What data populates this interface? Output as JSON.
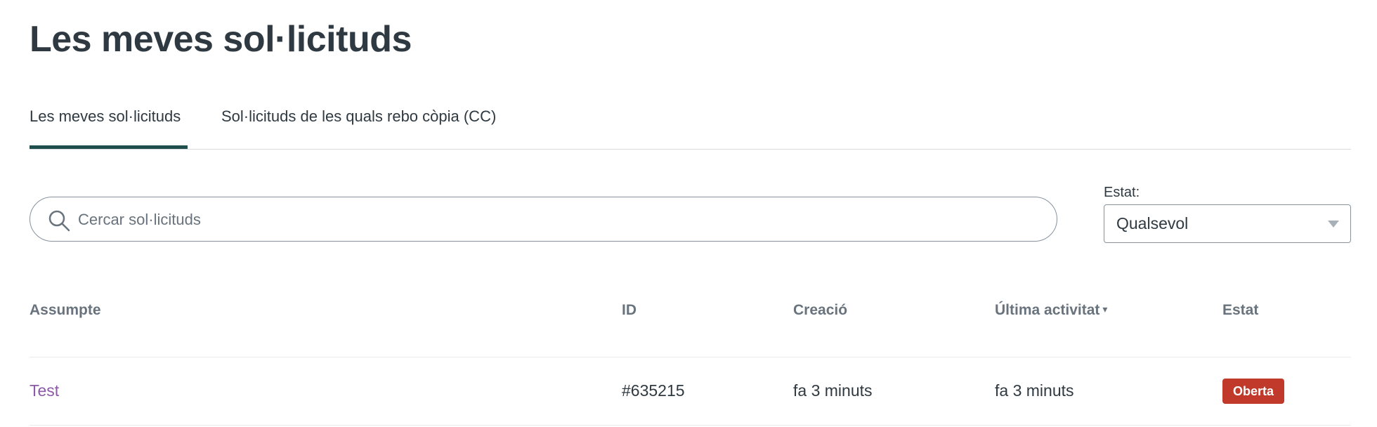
{
  "page": {
    "title": "Les meves sol·licituds"
  },
  "tabs": [
    {
      "label": "Les meves sol·licituds",
      "active": true
    },
    {
      "label": "Sol·licituds de les quals rebo còpia (CC)",
      "active": false
    }
  ],
  "search": {
    "placeholder": "Cercar sol·licituds",
    "value": "",
    "icon": "search-icon"
  },
  "status_filter": {
    "label": "Estat:",
    "selected": "Qualsevol",
    "icon": "chevron-down-icon"
  },
  "table": {
    "columns": [
      "Assumpte",
      "ID",
      "Creació",
      "Última activitat",
      "Estat"
    ],
    "sort_indicator": "▾",
    "rows": [
      {
        "subject": "Test",
        "id": "#635215",
        "created": "fa 3 minuts",
        "last_activity": "fa 3 minuts",
        "status": "Oberta"
      }
    ]
  },
  "colors": {
    "accent": "#1f4f4d",
    "link": "#8d5aa8",
    "status_open": "#c0392b",
    "text": "#2f3941",
    "muted": "#68737d"
  }
}
